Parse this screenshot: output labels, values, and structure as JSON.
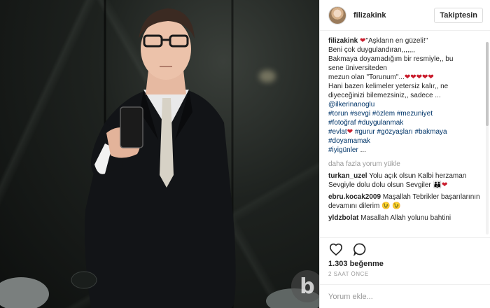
{
  "post": {
    "username": "filizakink",
    "follow_label": "Takiptesin",
    "caption_user": "filizakink",
    "caption_lines": [
      [
        "\"Aşkların en güzeli!\""
      ],
      [
        "Beni çok duygulandıran,,,,,,,"
      ],
      [
        "Bakmaya doyamadığım bir resmiyle,, bu"
      ],
      [
        "sene üniversiteden"
      ],
      [
        "mezun olan \"Torunum\"..."
      ],
      [
        "Hani bazen kelimeler yetersiz kalır,, ne"
      ],
      [
        "diyeceğinizi bilemezsiniz,, sadece ..."
      ]
    ],
    "mention": "@ilkerinanoglu",
    "hashtags_lines": [
      [
        "#torun",
        "#sevgi",
        "#özlem",
        "#mezuniyet"
      ],
      [
        "#fotoğraf",
        "#duygulanmak"
      ],
      [
        "#evlat",
        "#gurur",
        "#gözyaşları",
        "#bakmaya"
      ],
      [
        "#doyamamak"
      ],
      [
        "#iyigünler",
        "..."
      ]
    ],
    "load_more": "daha fazla yorum yükle",
    "comments": [
      {
        "user": "turkan_uzel",
        "text": "Yolu açık olsun Kalbi herzaman Sevgiyle dolu dolu olsun Sevgiler"
      },
      {
        "user": "ebru.kocak2009",
        "text": "Maşallah Tebrikler başarılarının devamını dilerim 😉 😉"
      },
      {
        "user": "yldzbolat",
        "text": "Masallah Allah yolunu bahtini"
      }
    ],
    "likes": "1.303 beğenme",
    "time": "2 SAAT ÖNCE",
    "comment_placeholder": "Yorum ekle...",
    "watermark": "b"
  },
  "colors": {
    "heart": "#c91c2c",
    "link": "#003569"
  },
  "icons": [
    "heart-outline-icon",
    "comment-bubble-icon"
  ]
}
